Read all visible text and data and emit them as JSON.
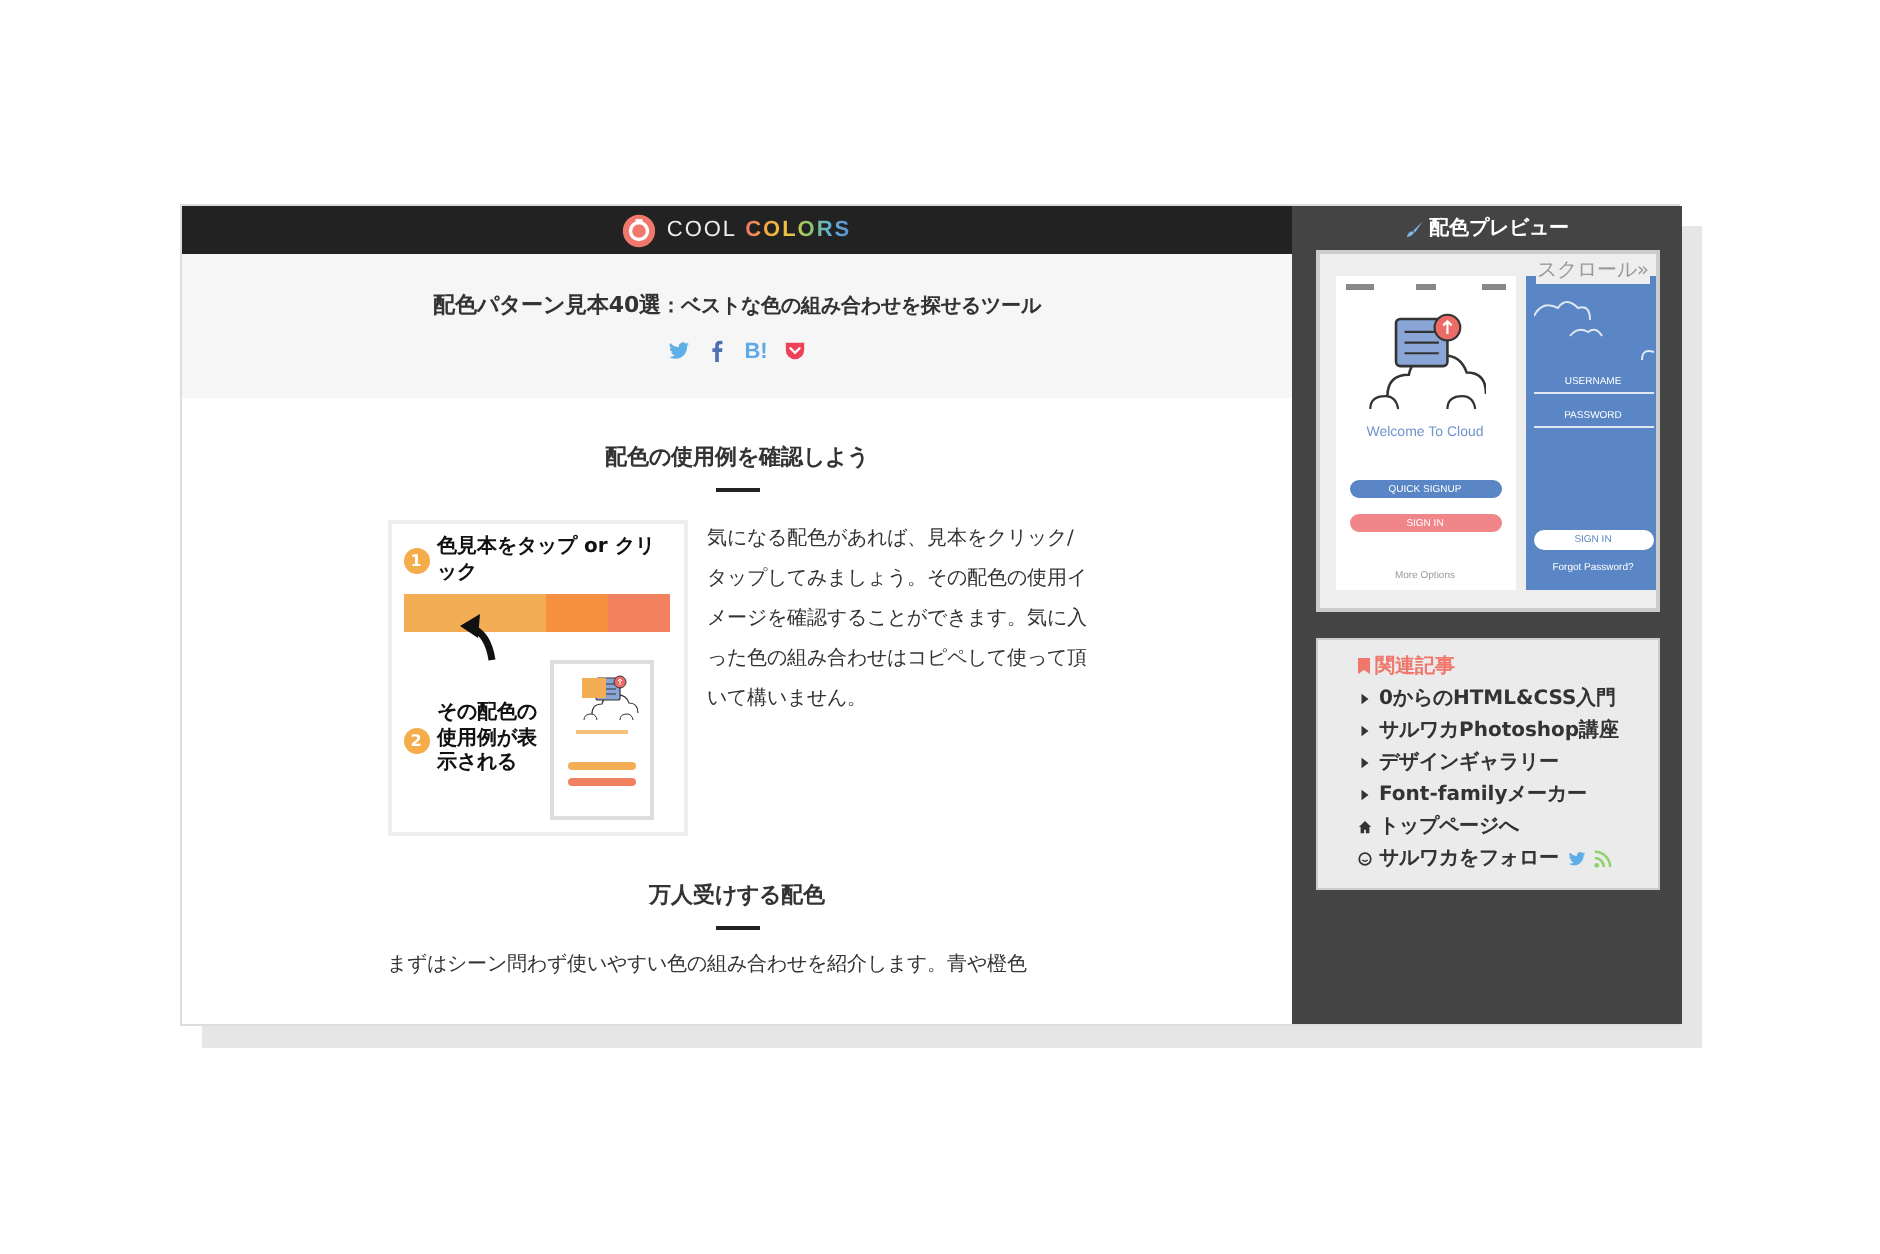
{
  "header": {
    "logo": {
      "word": "COOL",
      "accent": "COLORS"
    }
  },
  "hero": {
    "title": "**配色パターン見本40選**：ベストな色の組み合わせを探せるツール",
    "share": [
      {
        "kind": "twitter"
      },
      {
        "kind": "facebook"
      },
      {
        "kind": "hatena",
        "label": "B!"
      },
      {
        "kind": "pocket"
      }
    ]
  },
  "sections": [
    {
      "heading": "配色の使用例を確認しよう",
      "figure": {
        "steps": [
          {
            "number": "1",
            "label": "色見本をタップ or クリック"
          },
          {
            "number": "2",
            "label": "その配色の使用例が表示される"
          }
        ],
        "swatches": [
          {
            "color": "#f2ad55"
          },
          {
            "color": "#f79041"
          },
          {
            "color": "#f2825f"
          }
        ]
      },
      "text": "気になる配色があれば、見本をクリック/タップしてみましょう。その配色の使用イメージを確認することができます。気に入った色の組み合わせはコピペして使って頂いて構いません。"
    },
    {
      "heading": "万人受けする配色",
      "text": "まずはシーン問わず使いやすい色の組み合わせを紹介します。青や橙色"
    }
  ],
  "sidebar": {
    "title": "配色プレビュー",
    "preview": {
      "scroll_hint": "スクロール»",
      "screens": [
        {
          "kind": "welcome",
          "heading": "Welcome To Cloud",
          "buttons": [
            "QUICK SIGNUP",
            "SIGN IN"
          ],
          "footer": "More Options"
        },
        {
          "kind": "login",
          "fields": [
            "USERNAME",
            "PASSWORD"
          ],
          "buttons": [
            "SIGN IN"
          ],
          "footer": "Forgot Password?"
        }
      ]
    },
    "related": {
      "title": "関連記事",
      "links": [
        {
          "kind": "article",
          "label": "0からのHTML&CSS入門"
        },
        {
          "kind": "article",
          "label": "サルワカPhotoshop講座"
        },
        {
          "kind": "article",
          "label": "デザインギャラリー"
        },
        {
          "kind": "article",
          "label": "Font-familyメーカー"
        },
        {
          "kind": "home",
          "label": "トップページへ"
        },
        {
          "kind": "follow",
          "label": "サルワカをフォロー"
        }
      ]
    }
  }
}
